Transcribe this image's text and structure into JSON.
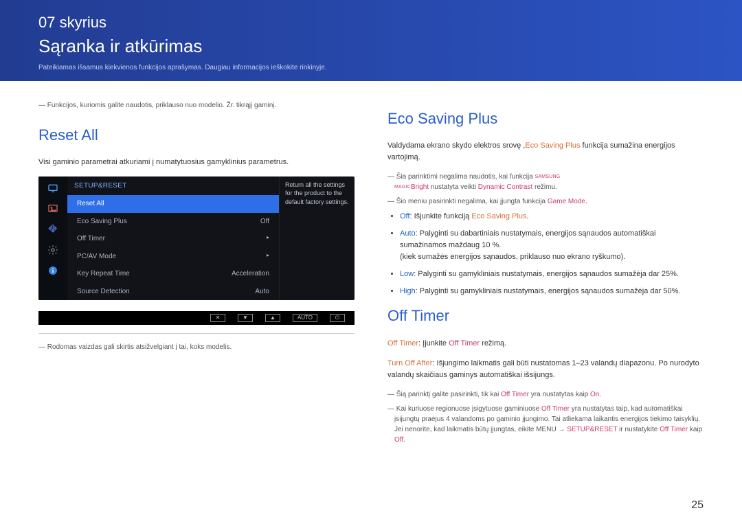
{
  "header": {
    "chapter": "07 skyrius",
    "title": "Sąranka ir atkūrimas",
    "sub": "Pateikiamas išsamus kiekvienos funkcijos aprašymas. Daugiau informacijos ieškokite rinkinyje."
  },
  "left": {
    "note": "Funkcijos, kuriomis galite naudotis, priklauso nuo modelio. Žr. tikrąjį gaminį.",
    "heading": "Reset All",
    "para": "Visi gaminio parametrai atkuriami į numatytuosius gamyklinius parametrus.",
    "osd": {
      "title": "SETUP&RESET",
      "rows": [
        {
          "label": "Reset All",
          "value": "",
          "selected": true
        },
        {
          "label": "Eco Saving Plus",
          "value": "Off"
        },
        {
          "label": "Off Timer",
          "value": "▸"
        },
        {
          "label": "PC/AV Mode",
          "value": "▸"
        },
        {
          "label": "Key Repeat Time",
          "value": "Acceleration"
        },
        {
          "label": "Source Detection",
          "value": "Auto"
        }
      ],
      "desc": "Return all the settings for the product to the default factory settings.",
      "footer_auto": "AUTO"
    },
    "under": "Rodomas vaizdas gali skirtis atsižvelgiant į tai, koks modelis."
  },
  "right": {
    "h1": "Eco Saving Plus",
    "intro_a": "Valdydama ekrano skydo elektros srovę ,",
    "intro_link": "Eco Saving Plus",
    "intro_b": " funkcija sumažina energijos vartojimą.",
    "note1_a": "Šia parinktimi negalima naudotis, kai funkcija ",
    "note1_bright": "Bright",
    "note1_b": " nustatyta veikti ",
    "note1_dyn": "Dynamic Contrast",
    "note1_c": " režimu.",
    "note2_a": "Šio meniu pasirinkti negalima, kai įjungta funkcija ",
    "note2_game": "Game Mode",
    "note2_b": ".",
    "bullets": [
      {
        "label": "Off",
        "text_a": ": Išjunkite funkciją ",
        "link": "Eco Saving Plus",
        "text_b": "."
      },
      {
        "label": "Auto",
        "text_a": ": Palyginti su dabartiniais nustatymais, energijos sąnaudos automatiškai sumažinamos maždaug 10 %.",
        "extra": "(kiek sumažės energijos sąnaudos, priklauso nuo ekrano ryškumo)."
      },
      {
        "label": "Low",
        "text_a": ": Palyginti su gamykliniais nustatymais, energijos sąnaudos sumažėja dar 25%."
      },
      {
        "label": "High",
        "text_a": ": Palyginti su gamykliniais nustatymais, energijos sąnaudos sumažėja dar 50%."
      }
    ],
    "h2": "Off Timer",
    "off_a": "Off Timer",
    "off_b": ": Įjunkite ",
    "off_c": "Off Timer",
    "off_d": " režimą.",
    "turn_a": "Turn Off After",
    "turn_b": ": Išjungimo laikmatis gali būti nustatomas 1–23 valandų diapazonu. Po nurodyto valandų skaičiaus gaminys automatiškai išsijungs.",
    "note3_a": "Šią parinktį galite pasirinkti, tik kai ",
    "note3_b": "Off Timer",
    "note3_c": " yra nustatytas kaip ",
    "note3_d": "On",
    "note3_e": ".",
    "note4_a": "Kai kuriuose regionuose įsigytuose gaminiuose ",
    "note4_b": "Off Timer",
    "note4_c": " yra nustatytas taip, kad automatiškai įsijungtų praėjus 4 valandoms po gaminio įjungimo. Tai atliekama laikantis energijos tiekimo taisyklių. Jei nenorite, kad laikmatis būtų įjungtas, eikite MENU → ",
    "note4_d": "SETUP&RESET",
    "note4_e": " ir nustatykite ",
    "note4_f": "Off Timer",
    "note4_g": " kaip ",
    "note4_h": "Off",
    "note4_i": "."
  },
  "pagenum": "25"
}
